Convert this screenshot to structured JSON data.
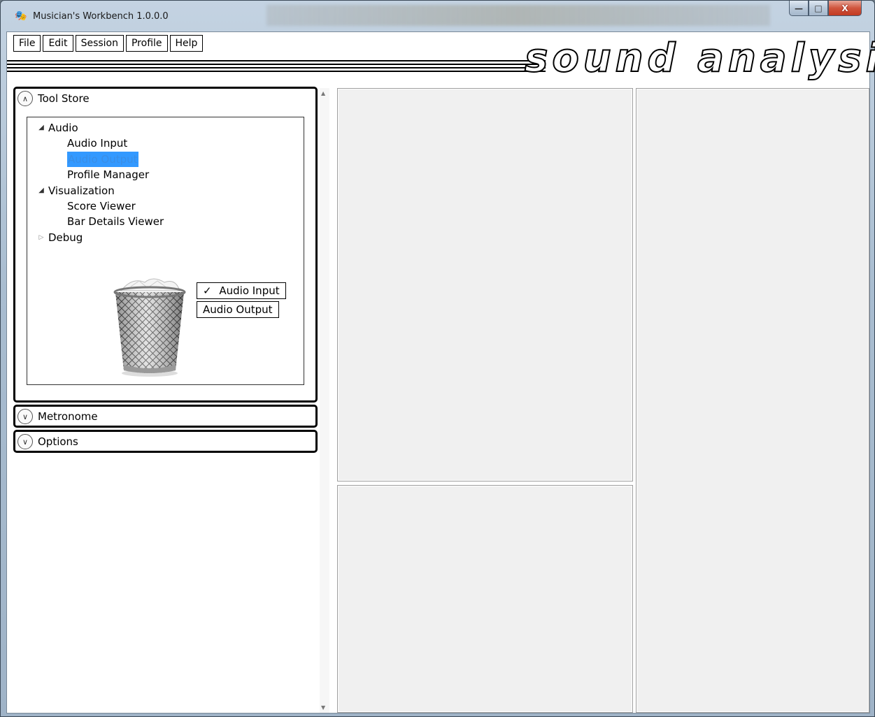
{
  "window": {
    "title": "Musician's Workbench 1.0.0.0",
    "app_icon": "mask-icon",
    "caption": {
      "minimize": "—",
      "maximize": "□",
      "close": "X"
    }
  },
  "menu": {
    "items": [
      "File",
      "Edit",
      "Session",
      "Profile",
      "Help"
    ]
  },
  "banner": {
    "text": "sound analysis"
  },
  "tool_store": {
    "header": "Tool Store",
    "expanded": true,
    "tree": [
      {
        "label": "Audio",
        "expanded": true,
        "children": [
          "Audio Input",
          "Audio Output",
          "Profile Manager"
        ]
      },
      {
        "label": "Visualization",
        "expanded": true,
        "children": [
          "Score Viewer",
          "Bar Details Viewer"
        ]
      },
      {
        "label": "Debug",
        "expanded": false,
        "children": []
      }
    ],
    "selected_item": "Audio Output",
    "chips": [
      {
        "label": "Audio Input",
        "checked": true,
        "check_mark": "✓"
      },
      {
        "label": "Audio Output",
        "checked": false
      }
    ],
    "trash_icon": "recycle-bin-icon"
  },
  "metronome": {
    "header": "Metronome",
    "expanded": false
  },
  "options": {
    "header": "Options",
    "expanded": false
  },
  "colors": {
    "selection": "#3399ff",
    "pane_bg": "#f0f0f0",
    "close_button": "#c23a22"
  }
}
